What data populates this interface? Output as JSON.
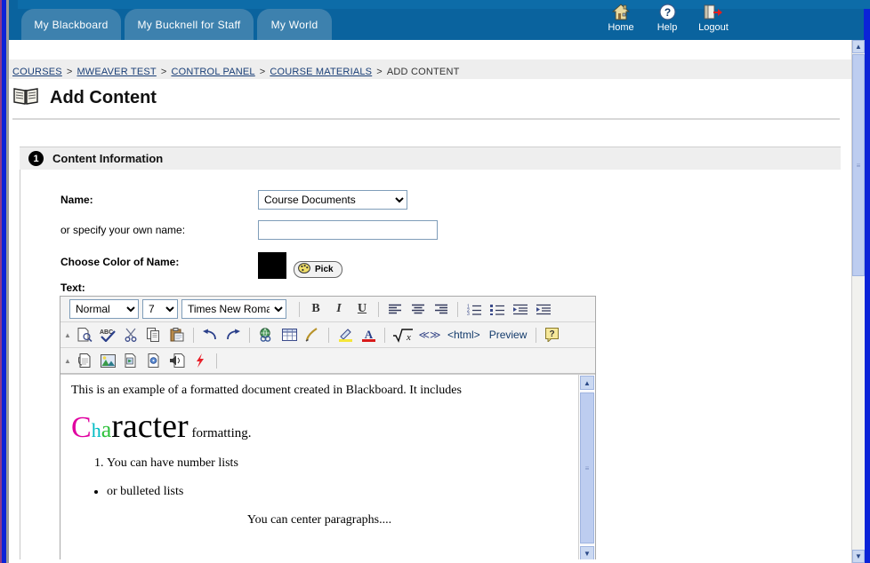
{
  "window": {
    "tabs": [
      {
        "label": "My Blackboard",
        "name": "tab-my-blackboard"
      },
      {
        "label": "My Bucknell for Staff",
        "name": "tab-my-bucknell-for-staff"
      },
      {
        "label": "My World",
        "name": "tab-my-world"
      }
    ],
    "toplinks": [
      {
        "label": "Home",
        "icon": "home-icon"
      },
      {
        "label": "Help",
        "icon": "help-icon"
      },
      {
        "label": "Logout",
        "icon": "logout-icon"
      }
    ]
  },
  "breadcrumb": {
    "items": [
      "COURSES",
      "MWEAVER TEST",
      "CONTROL PANEL",
      "COURSE MATERIALS"
    ],
    "current": "ADD CONTENT",
    "separator": ">"
  },
  "page": {
    "title": "Add Content",
    "title_icon": "open-book-icon"
  },
  "section": {
    "number": "1",
    "title": "Content Information"
  },
  "form": {
    "name_label": "Name:",
    "name_value": "Course Documents",
    "name_options": [
      "Course Documents"
    ],
    "own_name_label": "or specify your own name:",
    "own_name_value": "",
    "own_name_placeholder": "",
    "color_label": "Choose Color of Name:",
    "color_value": "#000000",
    "pick_label": "Pick"
  },
  "editor": {
    "text_label": "Text:",
    "style_value": "Normal",
    "style_options": [
      "Normal"
    ],
    "size_value": "7",
    "size_options": [
      "7"
    ],
    "font_value": "Times New Roman",
    "font_options": [
      "Times New Roman"
    ],
    "row1": [
      {
        "name": "bold-icon",
        "glyph": "B",
        "style": "font-weight:bold;font-family:'Liberation Serif',serif;"
      },
      {
        "name": "italic-icon",
        "glyph": "I",
        "style": "font-style:italic;font-family:'Liberation Serif',serif;font-weight:bold;"
      },
      {
        "name": "underline-icon",
        "glyph": "U",
        "style": "text-decoration:underline;font-family:'Liberation Serif',serif;font-weight:bold;"
      },
      {
        "name": "separator",
        "glyph": "",
        "style": ""
      },
      {
        "name": "align-left-icon",
        "glyph": "≡",
        "style": ""
      },
      {
        "name": "align-center-icon",
        "glyph": "≡",
        "style": ""
      },
      {
        "name": "align-right-icon",
        "glyph": "≡",
        "style": ""
      },
      {
        "name": "separator",
        "glyph": "",
        "style": ""
      },
      {
        "name": "numbered-list-icon",
        "glyph": "",
        "style": ""
      },
      {
        "name": "bulleted-list-icon",
        "glyph": "",
        "style": ""
      },
      {
        "name": "outdent-icon",
        "glyph": "",
        "style": ""
      },
      {
        "name": "indent-icon",
        "glyph": "",
        "style": ""
      }
    ],
    "row2": [
      {
        "name": "preview-document-icon"
      },
      {
        "name": "spellcheck-icon"
      },
      {
        "name": "cut-icon"
      },
      {
        "name": "copy-icon"
      },
      {
        "name": "paste-icon"
      },
      {
        "name": "separator"
      },
      {
        "name": "undo-icon"
      },
      {
        "name": "redo-icon"
      },
      {
        "name": "separator"
      },
      {
        "name": "insert-link-icon"
      },
      {
        "name": "insert-table-icon"
      },
      {
        "name": "pencil-icon"
      },
      {
        "name": "separator"
      },
      {
        "name": "highlighter-icon"
      },
      {
        "name": "font-color-icon"
      },
      {
        "name": "separator"
      },
      {
        "name": "math-equation-icon"
      },
      {
        "name": "special-character-icon"
      }
    ],
    "row2_text": [
      {
        "name": "html-source-button",
        "label": "<html>"
      },
      {
        "name": "preview-button",
        "label": "Preview"
      }
    ],
    "help_label": "?",
    "row3": [
      {
        "name": "attach-file-icon"
      },
      {
        "name": "insert-image-icon"
      },
      {
        "name": "insert-video-icon"
      },
      {
        "name": "insert-media-icon"
      },
      {
        "name": "insert-audio-icon"
      },
      {
        "name": "insert-flash-icon"
      }
    ]
  },
  "document": {
    "intro": "This is an example of a formatted document created in Blackboard. It includes",
    "char_c": "C",
    "char_h": "h",
    "char_a": "a",
    "char_rest": "racter",
    "char_tail": " formatting.",
    "char_c_color": "#e000a0",
    "char_h_color": "#00bcc4",
    "char_a_color": "#2fc13c",
    "numbered_items": [
      "You can have number lists"
    ],
    "bulleted_items": [
      "or bulleted lists"
    ],
    "centered": "You can center paragraphs...."
  }
}
